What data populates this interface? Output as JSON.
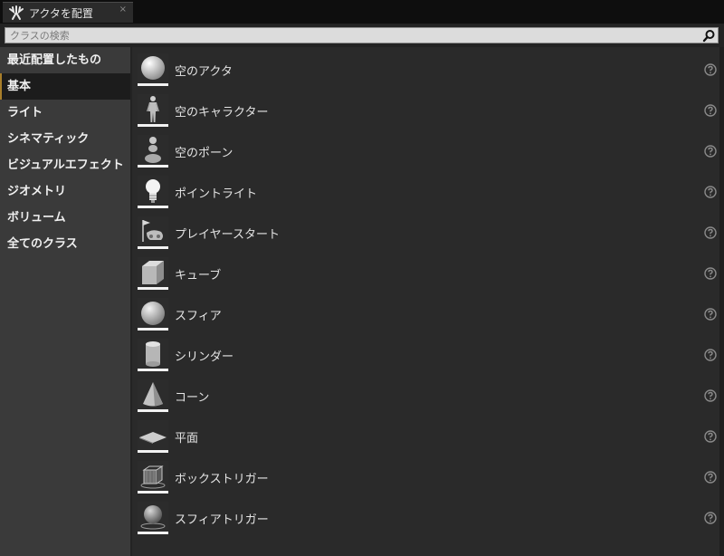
{
  "tab": {
    "title": "アクタを配置",
    "close": "×"
  },
  "search": {
    "placeholder": "クラスの検索",
    "value": ""
  },
  "categories": [
    {
      "label": "最近配置したもの"
    },
    {
      "label": "基本"
    },
    {
      "label": "ライト"
    },
    {
      "label": "シネマティック"
    },
    {
      "label": "ビジュアルエフェクト"
    },
    {
      "label": "ジオメトリ"
    },
    {
      "label": "ボリューム"
    },
    {
      "label": "全てのクラス"
    }
  ],
  "selected_category": "基本",
  "items": [
    {
      "label": "空のアクタ",
      "icon": "sphere-icon"
    },
    {
      "label": "空のキャラクター",
      "icon": "character-icon"
    },
    {
      "label": "空のポーン",
      "icon": "pawn-icon"
    },
    {
      "label": "ポイントライト",
      "icon": "lightbulb-icon"
    },
    {
      "label": "プレイヤースタート",
      "icon": "player-start-icon"
    },
    {
      "label": "キューブ",
      "icon": "cube-icon"
    },
    {
      "label": "スフィア",
      "icon": "sphere-icon"
    },
    {
      "label": "シリンダー",
      "icon": "cylinder-icon"
    },
    {
      "label": "コーン",
      "icon": "cone-icon"
    },
    {
      "label": "平面",
      "icon": "plane-icon"
    },
    {
      "label": "ボックストリガー",
      "icon": "box-trigger-icon"
    },
    {
      "label": "スフィアトリガー",
      "icon": "sphere-trigger-icon"
    }
  ],
  "colors": {
    "accent": "#a87e2a",
    "panel": "#2a2a2a",
    "sidebar": "#3a3a3a"
  }
}
